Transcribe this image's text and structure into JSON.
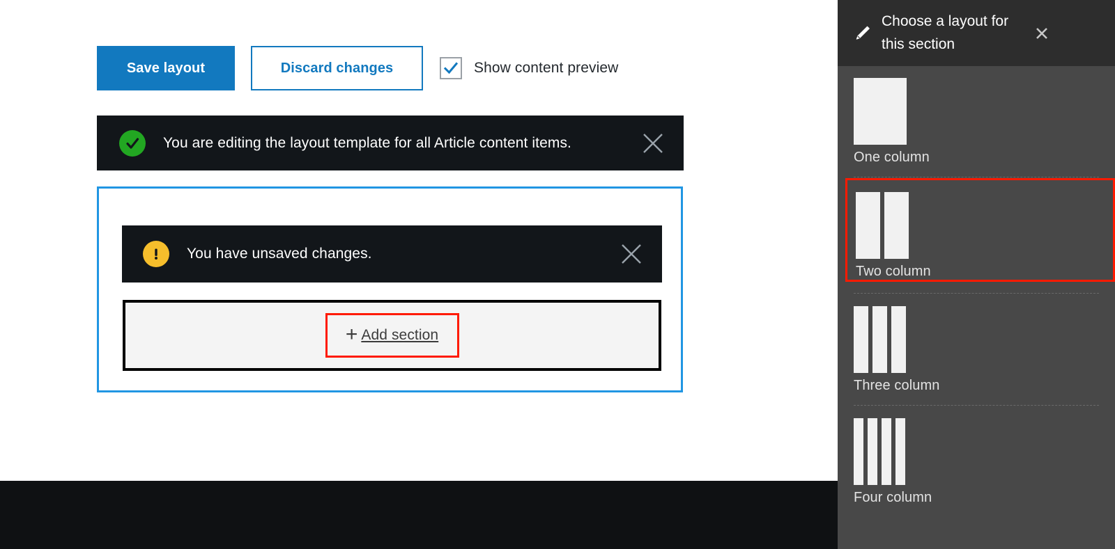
{
  "toolbar": {
    "save_label": "Save layout",
    "discard_label": "Discard changes",
    "preview_label": "Show content preview",
    "preview_checked": true,
    "checkbox_icon": "checkmark-icon",
    "save_bg": "#1279bf",
    "discard_color": "#1279bf"
  },
  "notices": {
    "success": {
      "icon": "success-check-icon",
      "icon_color": "#22a722",
      "text": "You are editing the layout template for all Article content items.",
      "close_icon": "close-icon"
    },
    "warning": {
      "icon": "warning-exclamation-icon",
      "icon_color": "#f6be2c",
      "text": "You have unsaved changes.",
      "close_icon": "close-icon"
    }
  },
  "section": {
    "add_section_label": "Add section",
    "add_section_plus_icon": "plus-icon",
    "highlight_color": "#ff1a00",
    "selected_border_color": "#2196e3"
  },
  "layout_panel": {
    "title": "Choose a layout for this section",
    "pencil_icon": "pencil-icon",
    "close_icon": "close-icon",
    "options": [
      {
        "label": "One column",
        "columns": 1,
        "selected": false
      },
      {
        "label": "Two column",
        "columns": 2,
        "selected": true
      },
      {
        "label": "Three column",
        "columns": 3,
        "selected": false
      },
      {
        "label": "Four column",
        "columns": 4,
        "selected": false
      }
    ]
  }
}
